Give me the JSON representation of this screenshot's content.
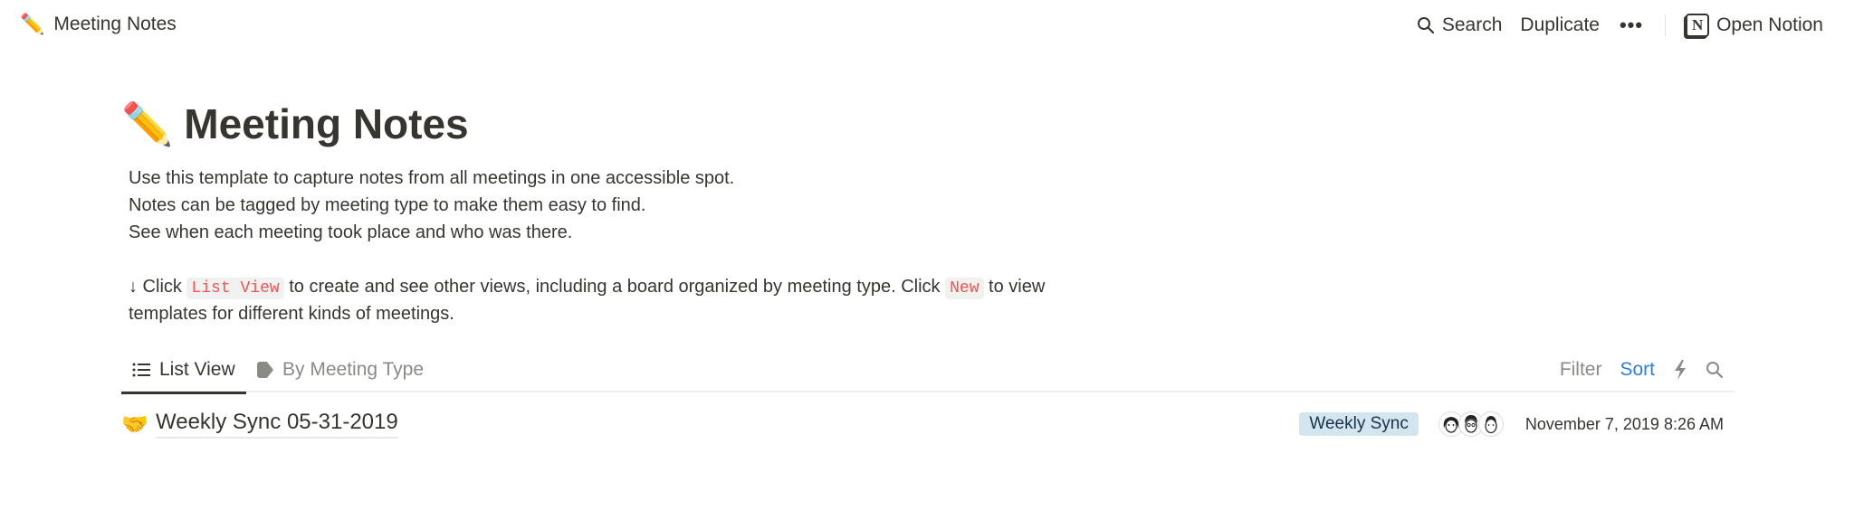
{
  "topbar": {
    "breadcrumb_emoji": "✏️",
    "breadcrumb_title": "Meeting Notes",
    "search_label": "Search",
    "duplicate_label": "Duplicate",
    "more_label": "•••",
    "open_notion_label": "Open Notion",
    "notion_logo_letter": "N"
  },
  "page": {
    "emoji": "✏️",
    "title": "Meeting Notes",
    "description": [
      "Use this template to capture notes from all meetings in one accessible spot.",
      "Notes can be tagged by meeting type to make them easy to find.",
      "See when each meeting took place and who was there."
    ],
    "hint": {
      "arrow": "↓",
      "part1": " Click ",
      "code1": "List View",
      "part2": " to create and see other views, including a board organized by meeting type. Click ",
      "code2": "New",
      "part3": " to view",
      "line2": "templates for different kinds of meetings."
    }
  },
  "views": {
    "tabs": [
      {
        "label": "List View",
        "icon": "list-icon",
        "active": true
      },
      {
        "label": "By Meeting Type",
        "icon": "tag-icon",
        "active": false
      }
    ],
    "filter_label": "Filter",
    "sort_label": "Sort"
  },
  "rows": [
    {
      "emoji": "🤝",
      "title": "Weekly Sync 05-31-2019",
      "tag": "Weekly Sync",
      "attendees": 3,
      "date": "November 7, 2019 8:26 AM"
    }
  ],
  "colors": {
    "text": "#37352f",
    "muted": "#8b8a86",
    "accent": "#2e7fd6",
    "code_text": "#eb5757",
    "tag_bg": "#d3e5ef"
  }
}
